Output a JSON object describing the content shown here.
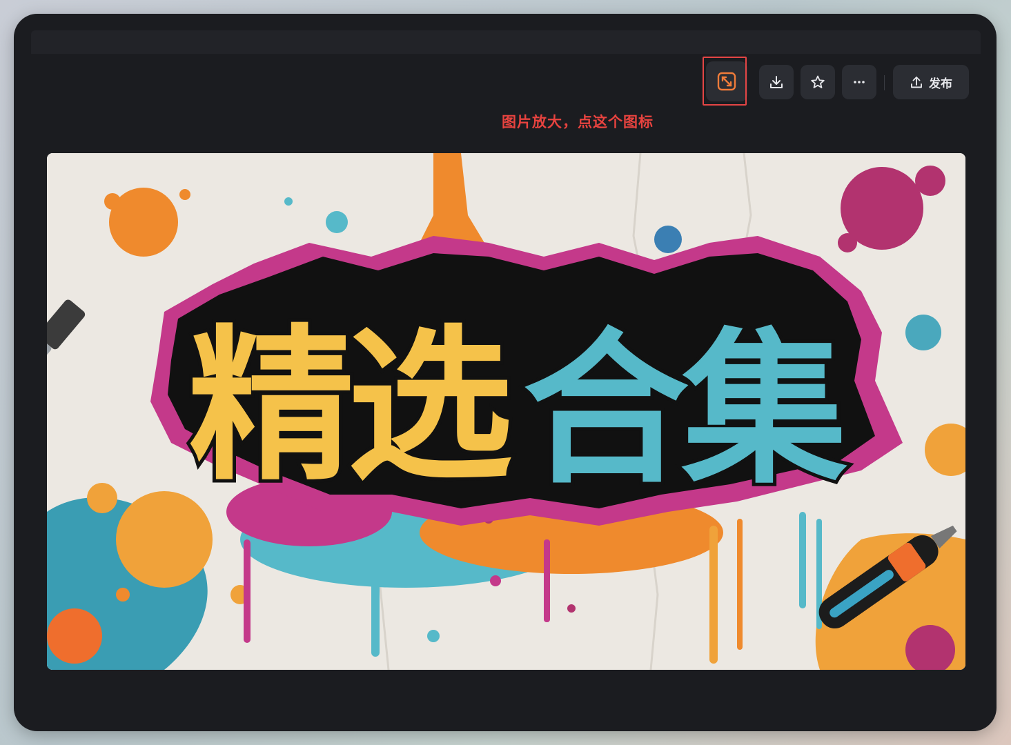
{
  "toolbar": {
    "zoom_icon": "zoom-expand-icon",
    "download_icon": "download-icon",
    "favorite_icon": "star-icon",
    "more_icon": "more-dots-icon",
    "publish_icon": "upload-icon",
    "publish_label": "发布"
  },
  "annotation": {
    "text": "图片放大，点这个图标",
    "color": "#e8433f"
  },
  "artwork": {
    "title_part1": "精选",
    "title_part2": "合集",
    "colors": {
      "yellow": "#f5c24a",
      "cyan": "#56b9c9",
      "magenta": "#c4398a",
      "orange": "#ef8a2d"
    }
  },
  "theme": {
    "panel_bg": "#1b1c20",
    "button_bg": "#2b2d33",
    "highlight": "#e54545",
    "accent_orange": "#f07c3a"
  }
}
